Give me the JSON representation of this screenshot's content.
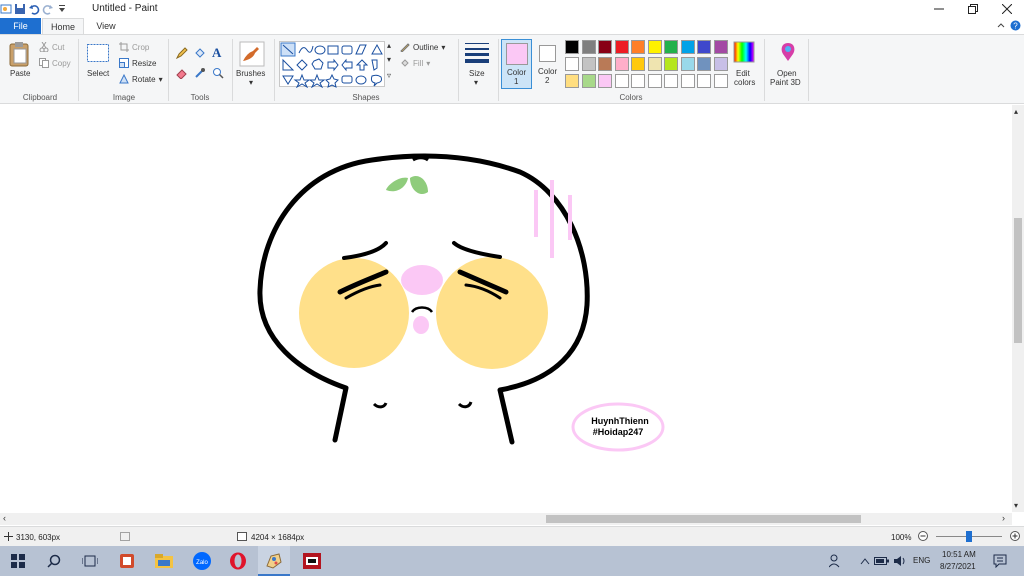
{
  "window": {
    "title": "Untitled - Paint",
    "controls": [
      "minimize",
      "maximize",
      "close"
    ]
  },
  "tabs": [
    {
      "label": "File"
    },
    {
      "label": "Home"
    },
    {
      "label": "View"
    }
  ],
  "clipboard": {
    "paste": "Paste",
    "cut": "Cut",
    "copy": "Copy",
    "group": "Clipboard"
  },
  "image": {
    "select": "Select",
    "crop": "Crop",
    "resize": "Resize",
    "rotate": "Rotate",
    "group": "Image"
  },
  "tools": {
    "group": "Tools",
    "text_tool": "A"
  },
  "brushes": {
    "label": "Brushes"
  },
  "shapes": {
    "outline": "Outline",
    "fill": "Fill",
    "group": "Shapes"
  },
  "size": {
    "label": "Size"
  },
  "colors": {
    "color1": "Color",
    "color1_num": "1",
    "color2": "Color",
    "color2_num": "2",
    "edit": "Edit",
    "edit2": "colors",
    "open3d": "Open",
    "open3d2": "Paint 3D",
    "group": "Colors",
    "color1_value": "#fbc8f5",
    "color2_value": "#ffffff",
    "palette_row1": [
      "#000000",
      "#7f7f7f",
      "#880015",
      "#ed1c24",
      "#ff7f27",
      "#fff200",
      "#22b14c",
      "#00a2e8",
      "#3f48cc",
      "#a349a4"
    ],
    "palette_row2": [
      "#ffffff",
      "#c3c3c3",
      "#b97a57",
      "#ffaec9",
      "#ffc90e",
      "#efe4b0",
      "#b5e61d",
      "#99d9ea",
      "#7092be",
      "#c8bfe7"
    ],
    "palette_row3": [
      "#ffde80",
      "#a8d98a",
      "#fbc8f5",
      "#ffffff",
      "#ffffff",
      "#ffffff",
      "#ffffff",
      "#ffffff",
      "#ffffff",
      "#ffffff"
    ]
  },
  "drawing": {
    "signature_line1": "HuynhThienn",
    "signature_line2": "#Hoidap247",
    "face_outline": "#000000",
    "cheek_color": "#ffe08a",
    "nose_color": "#fbc8f5",
    "leaf_color": "#8fcc7c"
  },
  "status": {
    "cursor": "3130, 603px",
    "dimensions": "4204 × 1684px",
    "zoom": "100%",
    "zoom_level": 1.0
  },
  "taskbar": {
    "lang": "ENG",
    "time": "10:51 AM",
    "date": "8/27/2021",
    "zalo": "Zalo"
  }
}
